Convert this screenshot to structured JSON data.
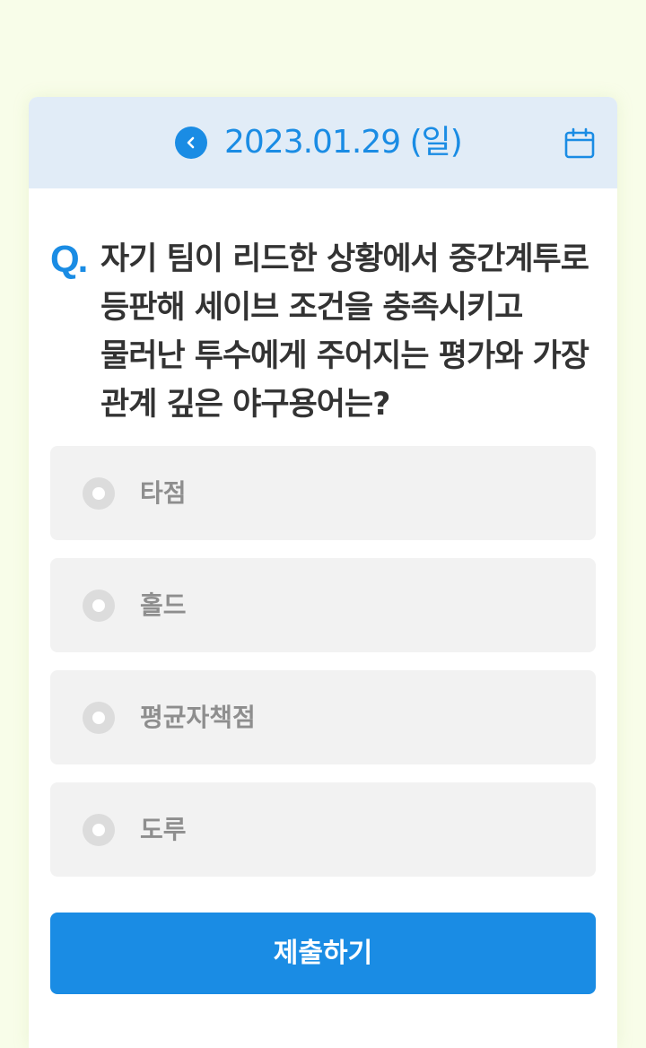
{
  "header": {
    "date": "2023.01.29 (일)",
    "prev_icon": "chevron-left-icon",
    "calendar_icon": "calendar-icon"
  },
  "question": {
    "marker": "Q.",
    "text": "자기 팀이 리드한 상황에서 중간계투로 등판해 세이브 조건을 충족시키고 물러난 투수에게 주어지는 평가와 가장 관계 깊은 야구용어는?"
  },
  "options": [
    {
      "label": "타점",
      "selected": false
    },
    {
      "label": "홀드",
      "selected": false
    },
    {
      "label": "평균자책점",
      "selected": false
    },
    {
      "label": "도루",
      "selected": false
    }
  ],
  "submit_label": "제출하기",
  "colors": {
    "accent": "#1a8ce4",
    "background": "#f8fde9",
    "header_bg": "#e1ecf7",
    "option_bg": "#f2f2f2",
    "text": "#333333",
    "option_text": "#8e8e8e"
  }
}
